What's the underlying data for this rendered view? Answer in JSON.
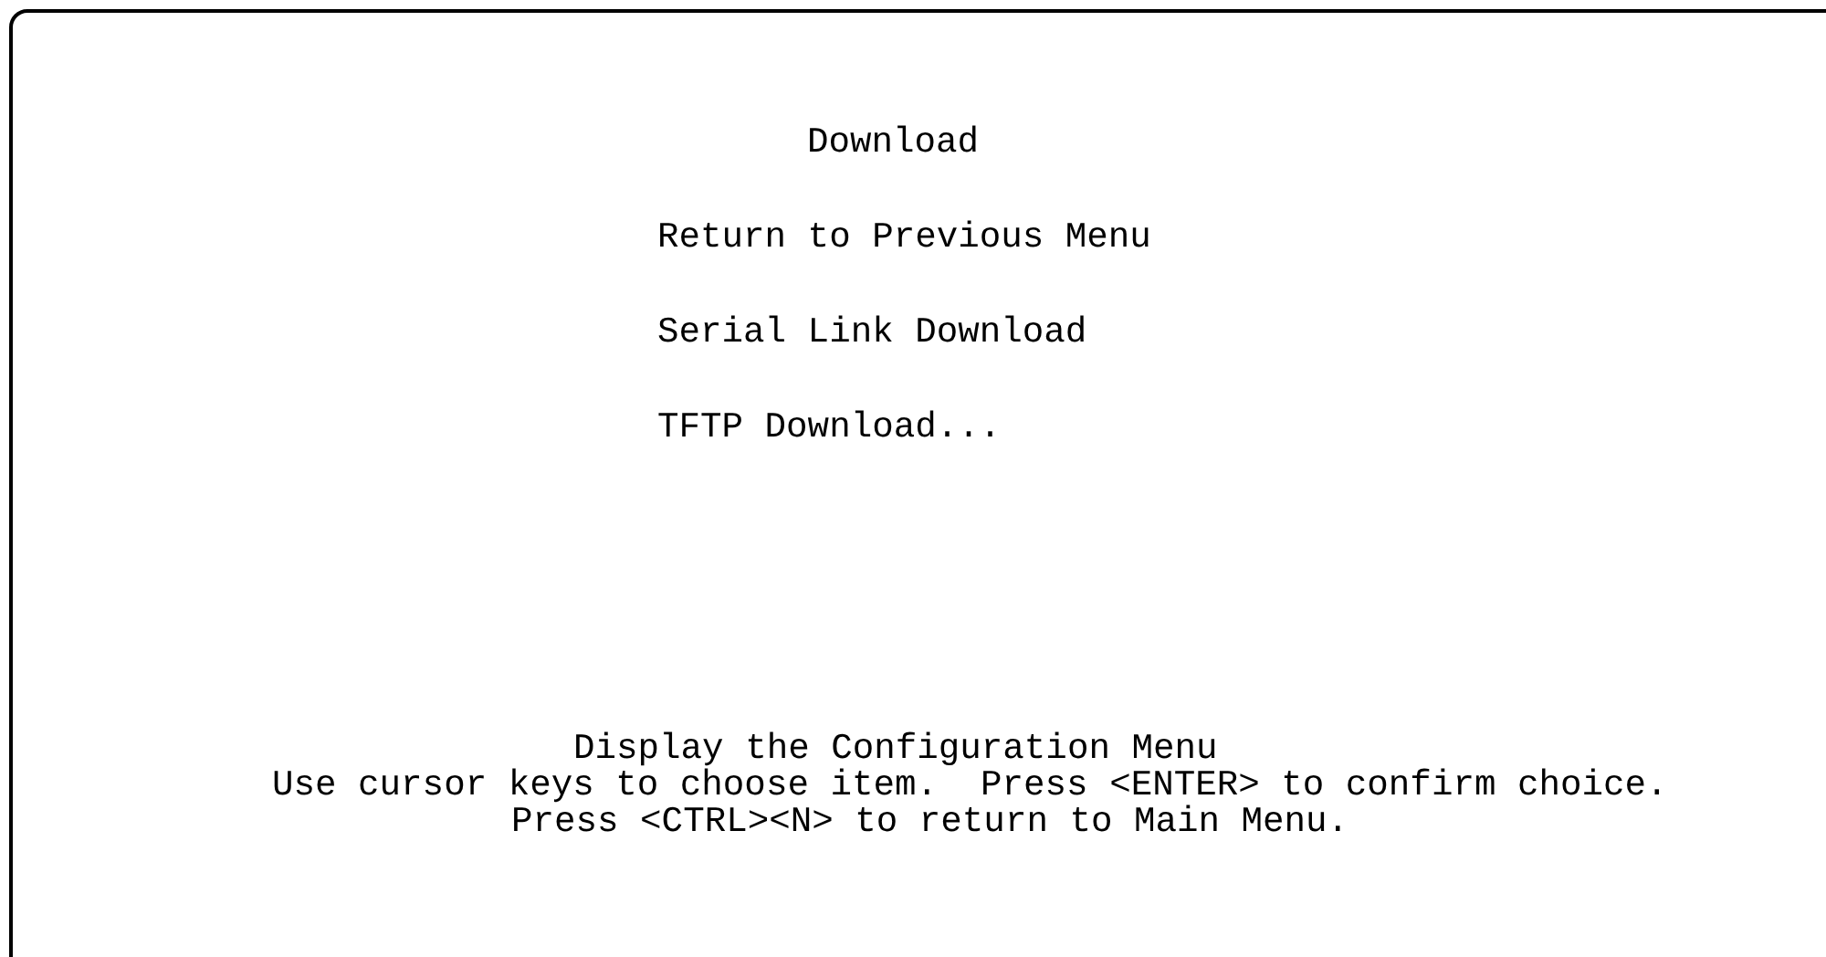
{
  "title": "Download",
  "menu_items": [
    {
      "label": "Return to Previous Menu"
    },
    {
      "label": "Serial Link Download"
    },
    {
      "label": "TFTP Download..."
    }
  ],
  "description": "Display the Configuration Menu",
  "help_lines": [
    "Use cursor keys to choose item.  Press <ENTER> to confirm choice.",
    "Press <CTRL><N> to return to Main Menu."
  ]
}
